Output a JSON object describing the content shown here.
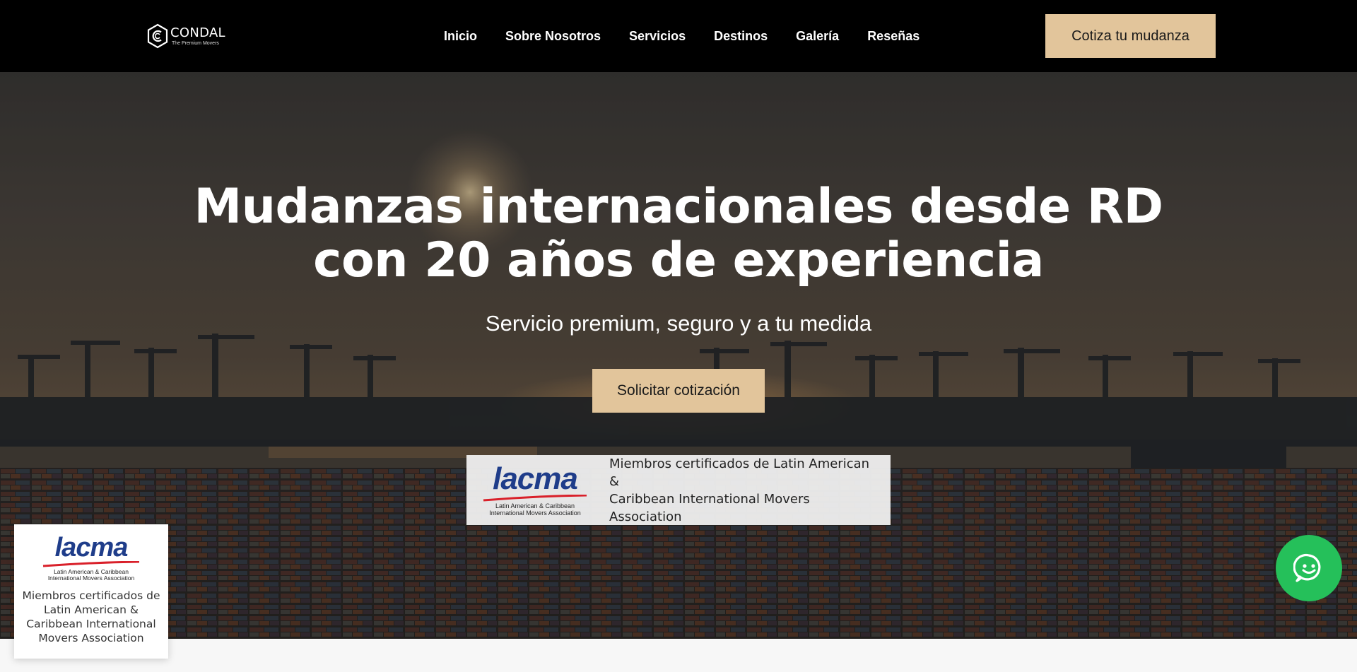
{
  "header": {
    "logo": {
      "name": "CONDAL",
      "tagline": "The Premium Movers",
      "icon": "hexagon-c-logo-icon"
    },
    "nav": [
      {
        "label": "Inicio"
      },
      {
        "label": "Sobre Nosotros"
      },
      {
        "label": "Servicios"
      },
      {
        "label": "Destinos"
      },
      {
        "label": "Galería"
      },
      {
        "label": "Reseñas"
      }
    ],
    "cta_label": "Cotiza tu mudanza"
  },
  "hero": {
    "title_line1": "Mudanzas internacionales desde RD",
    "title_line2": "con 20 años de experiencia",
    "subtitle": "Servicio premium, seguro y a tu medida",
    "cta_label": "Solicitar cotización",
    "background": "port-container-terminal-sunset-photo"
  },
  "certification": {
    "logo_word": "lacma",
    "logo_caption_line1": "Latin American & Caribbean",
    "logo_caption_line2": "International Movers Association",
    "center_text_line1": "Miembros certificados de Latin American &",
    "center_text_line2": "Caribbean International Movers Association",
    "float_text": "Miembros certificados de Latin American & Caribbean International Movers Association"
  },
  "whatsapp": {
    "icon": "whatsapp-icon"
  },
  "colors": {
    "header_bg": "#000000",
    "accent": "#e2c59b",
    "whatsapp_green": "#25c05a",
    "lacma_blue": "#1f3d8a",
    "lacma_red": "#d9202a"
  }
}
